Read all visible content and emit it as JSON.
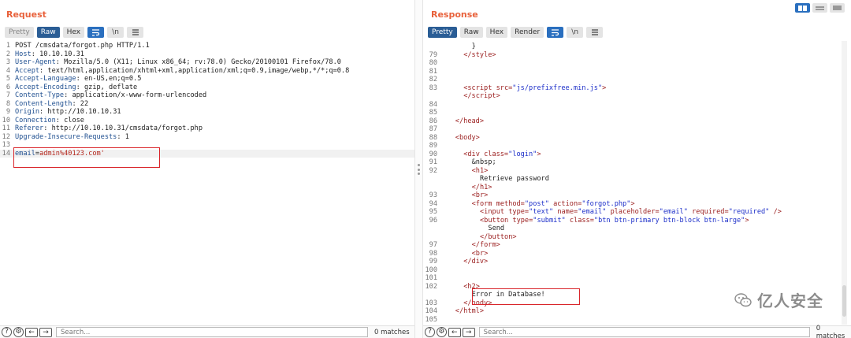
{
  "request": {
    "title": "Request",
    "tabs": {
      "pretty": "Pretty",
      "raw": "Raw",
      "hex": "Hex",
      "newline": "\\n"
    },
    "lines": [
      {
        "n": "1",
        "key": "",
        "value": "POST /cmsdata/forgot.php HTTP/1.1"
      },
      {
        "n": "2",
        "key": "Host",
        "value": " 10.10.10.31"
      },
      {
        "n": "3",
        "key": "User-Agent",
        "value": " Mozilla/5.0 (X11; Linux x86_64; rv:78.0) Gecko/20100101 Firefox/78.0"
      },
      {
        "n": "4",
        "key": "Accept",
        "value": " text/html,application/xhtml+xml,application/xml;q=0.9,image/webp,*/*;q=0.8"
      },
      {
        "n": "5",
        "key": "Accept-Language",
        "value": " en-US,en;q=0.5"
      },
      {
        "n": "6",
        "key": "Accept-Encoding",
        "value": " gzip, deflate"
      },
      {
        "n": "7",
        "key": "Content-Type",
        "value": " application/x-www-form-urlencoded"
      },
      {
        "n": "8",
        "key": "Content-Length",
        "value": " 22"
      },
      {
        "n": "9",
        "key": "Origin",
        "value": " http://10.10.10.31"
      },
      {
        "n": "10",
        "key": "Connection",
        "value": " close"
      },
      {
        "n": "11",
        "key": "Referer",
        "value": " http://10.10.10.31/cmsdata/forgot.php"
      },
      {
        "n": "12",
        "key": "Upgrade-Insecure-Requests",
        "value": " 1"
      },
      {
        "n": "13",
        "key": "",
        "value": ""
      }
    ],
    "body_line": {
      "n": "14",
      "param": "email",
      "eq": "=",
      "val": "admin%40123.com'"
    },
    "search_placeholder": "Search...",
    "matches": "0 matches"
  },
  "response": {
    "title": "Response",
    "tabs": {
      "pretty": "Pretty",
      "raw": "Raw",
      "hex": "Hex",
      "render": "Render",
      "newline": "\\n"
    },
    "lines": [
      {
        "n": "",
        "indent": 8,
        "html": "}"
      },
      {
        "n": "79",
        "indent": 6,
        "html": "<span class='tag'>&lt;/style&gt;</span>"
      },
      {
        "n": "80",
        "indent": 0,
        "html": ""
      },
      {
        "n": "81",
        "indent": 0,
        "html": ""
      },
      {
        "n": "82",
        "indent": 0,
        "html": ""
      },
      {
        "n": "83",
        "indent": 6,
        "html": "<span class='tag'>&lt;script </span><span class='attr'>src=</span><span class='aval'>\"js/prefixfree.min.js\"</span><span class='tag'>&gt;</span>"
      },
      {
        "n": "",
        "indent": 6,
        "html": "<span class='tag'>&lt;/script&gt;</span>"
      },
      {
        "n": "84",
        "indent": 0,
        "html": ""
      },
      {
        "n": "85",
        "indent": 0,
        "html": ""
      },
      {
        "n": "86",
        "indent": 4,
        "html": "<span class='tag'>&lt;/head&gt;</span>"
      },
      {
        "n": "87",
        "indent": 0,
        "html": ""
      },
      {
        "n": "88",
        "indent": 4,
        "html": "<span class='tag'>&lt;body&gt;</span>"
      },
      {
        "n": "89",
        "indent": 0,
        "html": ""
      },
      {
        "n": "90",
        "indent": 6,
        "html": "<span class='tag'>&lt;div </span><span class='attr'>class=</span><span class='aval'>\"login\"</span><span class='tag'>&gt;</span>"
      },
      {
        "n": "91",
        "indent": 8,
        "html": "&amp;nbsp;"
      },
      {
        "n": "92",
        "indent": 8,
        "html": "<span class='tag'>&lt;h1&gt;</span>"
      },
      {
        "n": "",
        "indent": 10,
        "html": "Retrieve password"
      },
      {
        "n": "",
        "indent": 8,
        "html": "<span class='tag'>&lt;/h1&gt;</span>"
      },
      {
        "n": "93",
        "indent": 8,
        "html": "<span class='tag'>&lt;br&gt;</span>"
      },
      {
        "n": "94",
        "indent": 8,
        "html": "<span class='tag'>&lt;form </span><span class='attr'>method=</span><span class='aval'>\"post\"</span><span class='attr'> action=</span><span class='aval'>\"forgot.php\"</span><span class='tag'>&gt;</span>"
      },
      {
        "n": "95",
        "indent": 10,
        "html": "<span class='tag'>&lt;input </span><span class='attr'>type=</span><span class='aval'>\"text\"</span><span class='attr'> name=</span><span class='aval'>\"email\"</span><span class='attr'> placeholder=</span><span class='aval'>\"email\"</span><span class='attr'> required=</span><span class='aval'>\"required\"</span><span class='tag'> /&gt;</span>"
      },
      {
        "n": "96",
        "indent": 10,
        "html": "<span class='tag'>&lt;button </span><span class='attr'>type=</span><span class='aval'>\"submit\"</span><span class='attr'> class=</span><span class='aval'>\"btn btn-primary btn-block btn-large\"</span><span class='tag'>&gt;</span>"
      },
      {
        "n": "",
        "indent": 12,
        "html": "Send"
      },
      {
        "n": "",
        "indent": 10,
        "html": "<span class='tag'>&lt;/button&gt;</span>"
      },
      {
        "n": "97",
        "indent": 8,
        "html": "<span class='tag'>&lt;/form&gt;</span>"
      },
      {
        "n": "98",
        "indent": 8,
        "html": "<span class='tag'>&lt;br&gt;</span>"
      },
      {
        "n": "99",
        "indent": 6,
        "html": "<span class='tag'>&lt;/div&gt;</span>"
      },
      {
        "n": "100",
        "indent": 0,
        "html": ""
      },
      {
        "n": "101",
        "indent": 0,
        "html": ""
      },
      {
        "n": "102",
        "indent": 6,
        "html": "<span class='tag'>&lt;h2&gt;</span>"
      },
      {
        "n": "",
        "indent": 8,
        "html": "Error in Database!"
      },
      {
        "n": "103",
        "indent": 6,
        "html": "<span class='tag'>&lt;/body&gt;</span>"
      },
      {
        "n": "104",
        "indent": 4,
        "html": "<span class='tag'>&lt;/html&gt;</span>"
      },
      {
        "n": "105",
        "indent": 0,
        "html": ""
      }
    ],
    "search_placeholder": "Search...",
    "matches": "0 matches"
  },
  "watermark": {
    "text": "亿人安全"
  },
  "colors": {
    "accent": "#e8613b",
    "active_tab": "#2a5d95",
    "highlight_box": "#d9262b"
  }
}
